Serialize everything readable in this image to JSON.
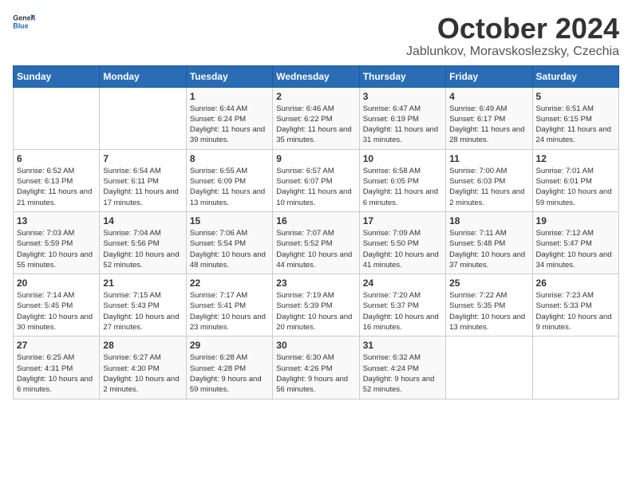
{
  "header": {
    "logo_general": "General",
    "logo_blue": "Blue",
    "month": "October 2024",
    "location": "Jablunkov, Moravskoslezsky, Czechia"
  },
  "weekdays": [
    "Sunday",
    "Monday",
    "Tuesday",
    "Wednesday",
    "Thursday",
    "Friday",
    "Saturday"
  ],
  "rows": [
    [
      {
        "day": "",
        "sunrise": "",
        "sunset": "",
        "daylight": ""
      },
      {
        "day": "",
        "sunrise": "",
        "sunset": "",
        "daylight": ""
      },
      {
        "day": "1",
        "sunrise": "Sunrise: 6:44 AM",
        "sunset": "Sunset: 6:24 PM",
        "daylight": "Daylight: 11 hours and 39 minutes."
      },
      {
        "day": "2",
        "sunrise": "Sunrise: 6:46 AM",
        "sunset": "Sunset: 6:22 PM",
        "daylight": "Daylight: 11 hours and 35 minutes."
      },
      {
        "day": "3",
        "sunrise": "Sunrise: 6:47 AM",
        "sunset": "Sunset: 6:19 PM",
        "daylight": "Daylight: 11 hours and 31 minutes."
      },
      {
        "day": "4",
        "sunrise": "Sunrise: 6:49 AM",
        "sunset": "Sunset: 6:17 PM",
        "daylight": "Daylight: 11 hours and 28 minutes."
      },
      {
        "day": "5",
        "sunrise": "Sunrise: 6:51 AM",
        "sunset": "Sunset: 6:15 PM",
        "daylight": "Daylight: 11 hours and 24 minutes."
      }
    ],
    [
      {
        "day": "6",
        "sunrise": "Sunrise: 6:52 AM",
        "sunset": "Sunset: 6:13 PM",
        "daylight": "Daylight: 11 hours and 21 minutes."
      },
      {
        "day": "7",
        "sunrise": "Sunrise: 6:54 AM",
        "sunset": "Sunset: 6:11 PM",
        "daylight": "Daylight: 11 hours and 17 minutes."
      },
      {
        "day": "8",
        "sunrise": "Sunrise: 6:55 AM",
        "sunset": "Sunset: 6:09 PM",
        "daylight": "Daylight: 11 hours and 13 minutes."
      },
      {
        "day": "9",
        "sunrise": "Sunrise: 6:57 AM",
        "sunset": "Sunset: 6:07 PM",
        "daylight": "Daylight: 11 hours and 10 minutes."
      },
      {
        "day": "10",
        "sunrise": "Sunrise: 6:58 AM",
        "sunset": "Sunset: 6:05 PM",
        "daylight": "Daylight: 11 hours and 6 minutes."
      },
      {
        "day": "11",
        "sunrise": "Sunrise: 7:00 AM",
        "sunset": "Sunset: 6:03 PM",
        "daylight": "Daylight: 11 hours and 2 minutes."
      },
      {
        "day": "12",
        "sunrise": "Sunrise: 7:01 AM",
        "sunset": "Sunset: 6:01 PM",
        "daylight": "Daylight: 10 hours and 59 minutes."
      }
    ],
    [
      {
        "day": "13",
        "sunrise": "Sunrise: 7:03 AM",
        "sunset": "Sunset: 5:59 PM",
        "daylight": "Daylight: 10 hours and 55 minutes."
      },
      {
        "day": "14",
        "sunrise": "Sunrise: 7:04 AM",
        "sunset": "Sunset: 5:56 PM",
        "daylight": "Daylight: 10 hours and 52 minutes."
      },
      {
        "day": "15",
        "sunrise": "Sunrise: 7:06 AM",
        "sunset": "Sunset: 5:54 PM",
        "daylight": "Daylight: 10 hours and 48 minutes."
      },
      {
        "day": "16",
        "sunrise": "Sunrise: 7:07 AM",
        "sunset": "Sunset: 5:52 PM",
        "daylight": "Daylight: 10 hours and 44 minutes."
      },
      {
        "day": "17",
        "sunrise": "Sunrise: 7:09 AM",
        "sunset": "Sunset: 5:50 PM",
        "daylight": "Daylight: 10 hours and 41 minutes."
      },
      {
        "day": "18",
        "sunrise": "Sunrise: 7:11 AM",
        "sunset": "Sunset: 5:48 PM",
        "daylight": "Daylight: 10 hours and 37 minutes."
      },
      {
        "day": "19",
        "sunrise": "Sunrise: 7:12 AM",
        "sunset": "Sunset: 5:47 PM",
        "daylight": "Daylight: 10 hours and 34 minutes."
      }
    ],
    [
      {
        "day": "20",
        "sunrise": "Sunrise: 7:14 AM",
        "sunset": "Sunset: 5:45 PM",
        "daylight": "Daylight: 10 hours and 30 minutes."
      },
      {
        "day": "21",
        "sunrise": "Sunrise: 7:15 AM",
        "sunset": "Sunset: 5:43 PM",
        "daylight": "Daylight: 10 hours and 27 minutes."
      },
      {
        "day": "22",
        "sunrise": "Sunrise: 7:17 AM",
        "sunset": "Sunset: 5:41 PM",
        "daylight": "Daylight: 10 hours and 23 minutes."
      },
      {
        "day": "23",
        "sunrise": "Sunrise: 7:19 AM",
        "sunset": "Sunset: 5:39 PM",
        "daylight": "Daylight: 10 hours and 20 minutes."
      },
      {
        "day": "24",
        "sunrise": "Sunrise: 7:20 AM",
        "sunset": "Sunset: 5:37 PM",
        "daylight": "Daylight: 10 hours and 16 minutes."
      },
      {
        "day": "25",
        "sunrise": "Sunrise: 7:22 AM",
        "sunset": "Sunset: 5:35 PM",
        "daylight": "Daylight: 10 hours and 13 minutes."
      },
      {
        "day": "26",
        "sunrise": "Sunrise: 7:23 AM",
        "sunset": "Sunset: 5:33 PM",
        "daylight": "Daylight: 10 hours and 9 minutes."
      }
    ],
    [
      {
        "day": "27",
        "sunrise": "Sunrise: 6:25 AM",
        "sunset": "Sunset: 4:31 PM",
        "daylight": "Daylight: 10 hours and 6 minutes."
      },
      {
        "day": "28",
        "sunrise": "Sunrise: 6:27 AM",
        "sunset": "Sunset: 4:30 PM",
        "daylight": "Daylight: 10 hours and 2 minutes."
      },
      {
        "day": "29",
        "sunrise": "Sunrise: 6:28 AM",
        "sunset": "Sunset: 4:28 PM",
        "daylight": "Daylight: 9 hours and 59 minutes."
      },
      {
        "day": "30",
        "sunrise": "Sunrise: 6:30 AM",
        "sunset": "Sunset: 4:26 PM",
        "daylight": "Daylight: 9 hours and 56 minutes."
      },
      {
        "day": "31",
        "sunrise": "Sunrise: 6:32 AM",
        "sunset": "Sunset: 4:24 PM",
        "daylight": "Daylight: 9 hours and 52 minutes."
      },
      {
        "day": "",
        "sunrise": "",
        "sunset": "",
        "daylight": ""
      },
      {
        "day": "",
        "sunrise": "",
        "sunset": "",
        "daylight": ""
      }
    ]
  ]
}
